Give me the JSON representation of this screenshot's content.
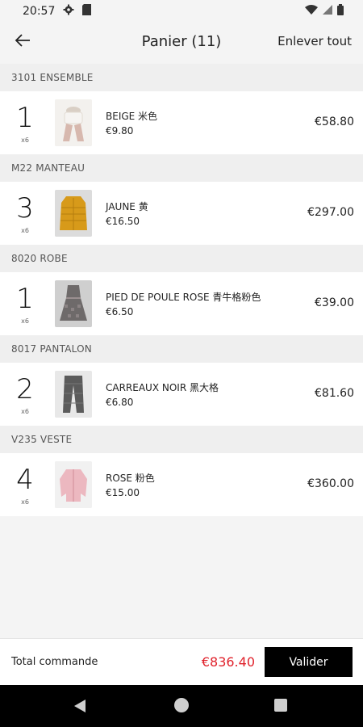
{
  "status_bar": {
    "time": "20:57"
  },
  "app_bar": {
    "title": "Panier (11)",
    "clear_label": "Enlever tout"
  },
  "sections": [
    {
      "header": "3101 ENSEMBLE",
      "item": {
        "qty": "1",
        "qty_unit": "x6",
        "name": "BEIGE 米色",
        "unit_price": "€9.80",
        "line_total": "€58.80"
      }
    },
    {
      "header": "M22 MANTEAU",
      "item": {
        "qty": "3",
        "qty_unit": "x6",
        "name": "JAUNE 黄",
        "unit_price": "€16.50",
        "line_total": "€297.00"
      }
    },
    {
      "header": "8020 ROBE",
      "item": {
        "qty": "1",
        "qty_unit": "x6",
        "name": "PIED DE POULE ROSE 青牛格粉色",
        "unit_price": "€6.50",
        "line_total": "€39.00"
      }
    },
    {
      "header": "8017 PANTALON",
      "item": {
        "qty": "2",
        "qty_unit": "x6",
        "name": "CARREAUX NOIR 黑大格",
        "unit_price": "€6.80",
        "line_total": "€81.60"
      }
    },
    {
      "header": "V235 VESTE",
      "item": {
        "qty": "4",
        "qty_unit": "x6",
        "name": "ROSE 粉色",
        "unit_price": "€15.00",
        "line_total": "€360.00"
      }
    }
  ],
  "footer": {
    "total_label": "Total commande",
    "total_value": "€836.40",
    "validate_label": "Valider"
  },
  "colors": {
    "accent_total": "#e0212b",
    "button_bg": "#000000"
  },
  "icons": [
    "settings-icon",
    "sim-icon",
    "wifi-icon",
    "signal-icon",
    "battery-icon",
    "back-arrow-icon",
    "nav-back-icon",
    "nav-home-icon",
    "nav-recents-icon"
  ]
}
